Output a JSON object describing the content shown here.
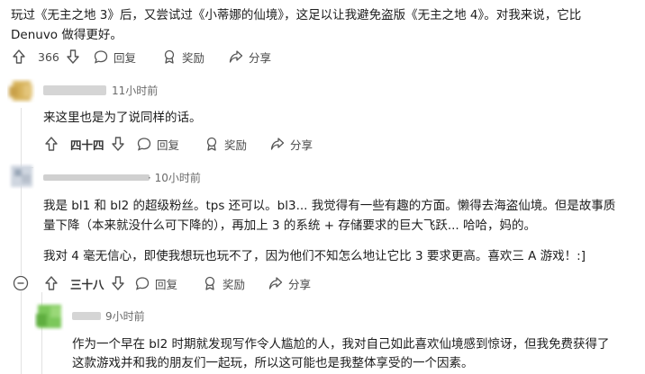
{
  "top_comment": {
    "line1": "玩过《无主之地 3》后，又尝试过《小蒂娜的仙境》，这足以让我避免盗版《无主之地 4》。对我来说，它比",
    "line2": "Denuvo 做得更好。",
    "votes": "366",
    "reply": "回复",
    "award": "奖励",
    "share": "分享"
  },
  "comment2": {
    "time": "11小时前",
    "text": "来这里也是为了说同样的话。",
    "votes": "四十四",
    "reply": "回复",
    "award": "奖励",
    "share": "分享"
  },
  "comment3": {
    "time": "· 10小时前",
    "p1_line1": "我是 bl1 和 bl2 的超级粉丝。tps 还可以。bl3... 我觉得有一些有趣的方面。懒得去海盗仙境。但是故事质",
    "p1_line2": "量下降（本来就没什么可下降的），再加上 3 的系统 + 存储要求的巨大飞跃... 哈哈，妈的。",
    "p2": "我对 4 毫无信心，即使我想玩也玩不了，因为他们不知怎么地让它比 3 要求更高。喜欢三 A 游戏！:]",
    "votes": "三十八",
    "reply": "回复",
    "award": "奖励",
    "share": "分享"
  },
  "comment4": {
    "time": "9小时前",
    "line1": "作为一个早在 bl2 时期就发现写作令人尴尬的人，我对自己如此喜欢仙境感到惊讶，但我免费获得了",
    "line2": "这款游戏并和我的朋友们一起玩，所以这可能也是我整体享受的一个因素。"
  },
  "icons": [
    "upvote-icon",
    "downvote-icon",
    "comment-icon",
    "award-icon",
    "share-icon",
    "collapse-icon"
  ],
  "colors": {
    "text": "#1c1c1c",
    "meta": "#6a6a6a",
    "thread_line": "#e2e2e2"
  }
}
